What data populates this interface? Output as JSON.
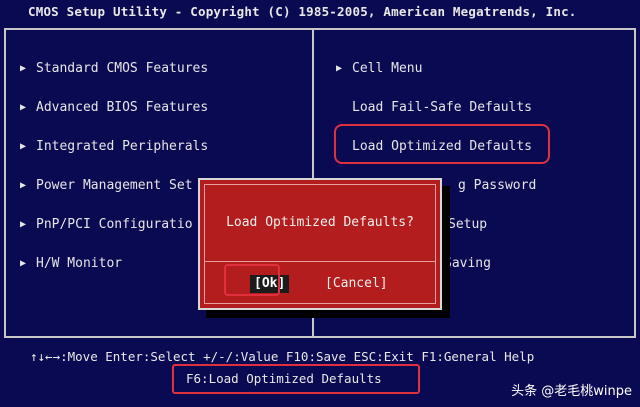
{
  "title": "CMOS Setup Utility - Copyright (C) 1985-2005, American Megatrends, Inc.",
  "left_menu": [
    {
      "label": "Standard CMOS Features"
    },
    {
      "label": "Advanced BIOS Features"
    },
    {
      "label": "Integrated Peripherals"
    },
    {
      "label": "Power Management Set"
    },
    {
      "label": "PnP/PCI Configuratio"
    },
    {
      "label": "H/W Monitor"
    }
  ],
  "right_menu": [
    {
      "label": "Cell Menu"
    },
    {
      "label": "Load Fail-Safe Defaults"
    },
    {
      "label": "Load Optimized Defaults"
    },
    {
      "label": "g Password"
    },
    {
      "label": "Setup"
    },
    {
      "label": "Saving"
    }
  ],
  "dialog": {
    "title": "Load Optimized Defaults?",
    "ok": "[Ok]",
    "cancel": "[Cancel]"
  },
  "footer": {
    "line1": "↑↓←→:Move  Enter:Select  +/-/:Value  F10:Save  ESC:Exit  F1:General Help",
    "line2": "F6:Load Optimized Defaults"
  },
  "watermark": "头条 @老毛桃winpe",
  "colors": {
    "background": "#0a0a52",
    "dialog": "#b31d1d",
    "highlight": "#e03040",
    "text": "#e8e8e8"
  },
  "icons": {
    "menu_arrow": "triangle-right-icon"
  }
}
